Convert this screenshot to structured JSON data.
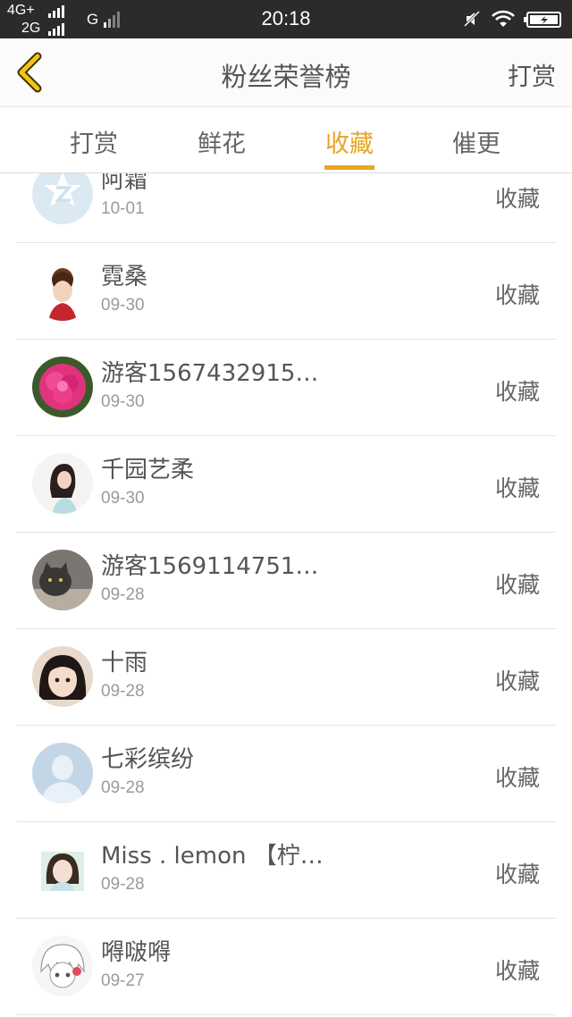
{
  "status_bar": {
    "network_top": "4G+",
    "network_bottom": "2G",
    "network_g": "G",
    "time": "20:18",
    "icons": [
      "signal-icon",
      "mute-icon",
      "wifi-icon",
      "battery-icon"
    ]
  },
  "header": {
    "back_icon": "chevron-left-icon",
    "title": "粉丝荣誉榜",
    "action": "打赏"
  },
  "tabs": [
    {
      "label": "打赏",
      "active": false
    },
    {
      "label": "鲜花",
      "active": false
    },
    {
      "label": "收藏",
      "active": true
    },
    {
      "label": "催更",
      "active": false
    }
  ],
  "colors": {
    "accent": "#e9a424",
    "status_bar": "#2b2b2b"
  },
  "list": [
    {
      "name": "阿霜",
      "date": "10-01",
      "type": "收藏",
      "avatar": "default-z-avatar"
    },
    {
      "name": "霓桑",
      "date": "09-30",
      "type": "收藏",
      "avatar": "warrior-girl-avatar"
    },
    {
      "name": "游客1567432915…",
      "date": "09-30",
      "type": "收藏",
      "avatar": "pink-flower-avatar"
    },
    {
      "name": "千园艺柔",
      "date": "09-30",
      "type": "收藏",
      "avatar": "woman-photo-avatar"
    },
    {
      "name": "游客1569114751…",
      "date": "09-28",
      "type": "收藏",
      "avatar": "cat-photo-avatar"
    },
    {
      "name": "十雨",
      "date": "09-28",
      "type": "收藏",
      "avatar": "child-photo-avatar"
    },
    {
      "name": "七彩缤纷",
      "date": "09-28",
      "type": "收藏",
      "avatar": "default-person-avatar"
    },
    {
      "name": "Miss . lemon 【柠…",
      "date": "09-28",
      "type": "收藏",
      "avatar": "girl-photo-avatar"
    },
    {
      "name": "嘚啵嘚",
      "date": "09-27",
      "type": "收藏",
      "avatar": "anime-avatar"
    }
  ]
}
